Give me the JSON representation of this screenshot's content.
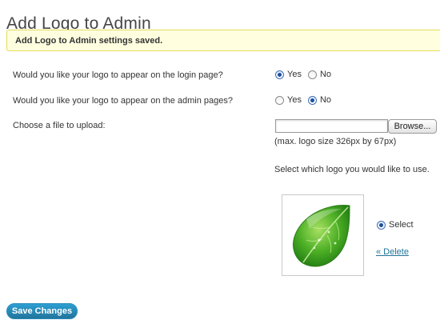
{
  "page": {
    "title": "Add Logo to Admin"
  },
  "notice": {
    "text": "Add Logo to Admin settings saved."
  },
  "login_question": {
    "label": "Would you like your logo to appear on the login page?",
    "options": [
      "Yes",
      "No"
    ],
    "selected": "Yes"
  },
  "admin_question": {
    "label": "Would you like your logo to appear on the admin pages?",
    "options": [
      "Yes",
      "No"
    ],
    "selected": "No"
  },
  "upload": {
    "label": "Choose a file to upload:",
    "value": "",
    "browse_label": "Browse...",
    "hint": "(max. logo size 326px by 67px)"
  },
  "logo_choice": {
    "prompt": "Select which logo you would like to use.",
    "image_icon": "green-leaf-logo",
    "select_label": "Select",
    "selected": true,
    "delete_label": "« Delete"
  },
  "save_button": {
    "label": "Save Changes"
  },
  "colors": {
    "notice_bg": "#ffffe0",
    "notice_border": "#e6db55",
    "link": "#21759b",
    "button": "#21759b"
  }
}
